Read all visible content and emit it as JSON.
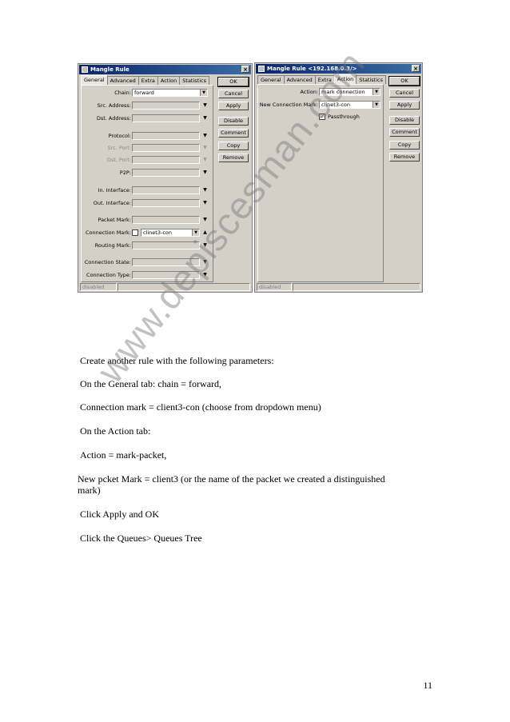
{
  "left_dialog": {
    "title": "Mangle Rule",
    "tabs": [
      "General",
      "Advanced",
      "Extra",
      "Action",
      "Statistics"
    ],
    "fields": [
      {
        "label": "Chain:",
        "value": "forward"
      },
      {
        "label": "Src. Address:",
        "value": ""
      },
      {
        "label": "Dst. Address:",
        "value": ""
      },
      {
        "label": "Protocol:",
        "value": ""
      },
      {
        "label": "Src. Port:",
        "value": ""
      },
      {
        "label": "Dst. Port:",
        "value": ""
      },
      {
        "label": "P2P:",
        "value": ""
      },
      {
        "label": "In. Interface:",
        "value": ""
      },
      {
        "label": "Out. Interface:",
        "value": ""
      },
      {
        "label": "Packet Mark:",
        "value": ""
      },
      {
        "label": "Connection Mark:",
        "value": "clinet3-con"
      },
      {
        "label": "Routing Mark:",
        "value": ""
      },
      {
        "label": "Connection State:",
        "value": ""
      },
      {
        "label": "Connection Type:",
        "value": ""
      }
    ],
    "buttons": [
      "OK",
      "Cancel",
      "Apply",
      "Disable",
      "Comment",
      "Copy",
      "Remove"
    ],
    "status": "disabled"
  },
  "right_dialog": {
    "title": "Mangle Rule <192.168.0.3/>",
    "tabs": [
      "General",
      "Advanced",
      "Extra",
      "Action",
      "Statistics"
    ],
    "fields": [
      {
        "label": "Action:",
        "value": "mark connection"
      },
      {
        "label": "New Connection Mark:",
        "value": "clinet3-con"
      }
    ],
    "passthrough_label": "Passthrough",
    "buttons": [
      "OK",
      "Cancel",
      "Apply",
      "Disable",
      "Comment",
      "Copy",
      "Remove"
    ],
    "status": "disabled"
  },
  "instructions": [
    "Create another rule with the following parameters:",
    "On the General tab: chain = forward,",
    "Connection mark = client3-con (choose from dropdown menu)",
    "On the Action tab:",
    "Action = mark-packet,",
    "New pcket Mark = client3 (or the name of the packet we created a distinguished",
    "mark)",
    "Click Apply and OK",
    "Click the Queues> Queues Tree"
  ],
  "watermark": "www.depiscesman.com",
  "page_number": "11"
}
